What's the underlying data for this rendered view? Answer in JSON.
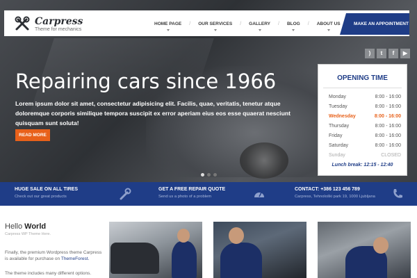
{
  "brand": {
    "name": "Carpress",
    "tagline": "Theme for mechanics"
  },
  "nav": {
    "items": [
      "HOME PAGE",
      "OUR SERVICES",
      "GALLERY",
      "BLOG",
      "ABOUT US"
    ],
    "cta": "MAKE AN APPOINTMENT"
  },
  "social": [
    "rss",
    "twitter",
    "facebook",
    "youtube"
  ],
  "hero": {
    "title": "Repairing cars since 1966",
    "text": "Lorem ipsum dolor sit amet, consectetur adipisicing elit. Facilis, quae, veritatis, tenetur atque doloremque corporis similique tempora suscipit ex error aperiam eius eos esse quaerat nesciunt quisquam sunt soluta!",
    "button": "READ MORE",
    "slides": 3,
    "active_slide": 1
  },
  "opening": {
    "title": "OPENING TIME",
    "days": [
      {
        "day": "Monday",
        "hours": "8:00 - 16:00"
      },
      {
        "day": "Tuesday",
        "hours": "8:00 - 16:00"
      },
      {
        "day": "Wednesday",
        "hours": "8:00 - 16:00"
      },
      {
        "day": "Thursday",
        "hours": "8:00 - 16:00"
      },
      {
        "day": "Friday",
        "hours": "8:00 - 16:00"
      },
      {
        "day": "Saturday",
        "hours": "8:00 - 16:00"
      },
      {
        "day": "Sunday",
        "hours": "CLOSED"
      }
    ],
    "lunch": "Lunch break: 12:15 - 12:40"
  },
  "infobar": [
    {
      "title": "HUGE SALE ON ALL TIRES",
      "sub": "Check out our great products",
      "icon": "wrench-icon"
    },
    {
      "title": "GET A FREE REPAIR QUOTE",
      "sub": "Send us a photo of a problem",
      "icon": "speedometer-icon"
    },
    {
      "title": "CONTACT: +386 123 456 789",
      "sub": "Carpress, Tehnološki park 19, 1000 Ljubljana",
      "icon": "phone-icon"
    }
  ],
  "welcome": {
    "hello": "Hello",
    "world": "World",
    "sub": "Carpress WP Theme Here.",
    "intro1": "Finally, the premium Wordpress theme Carpress is available for purchase on",
    "intro_link": "ThemeForest.",
    "intro2": "The theme includes many different options."
  },
  "colors": {
    "accent": "#1f3d87",
    "orange": "#e8611a"
  }
}
